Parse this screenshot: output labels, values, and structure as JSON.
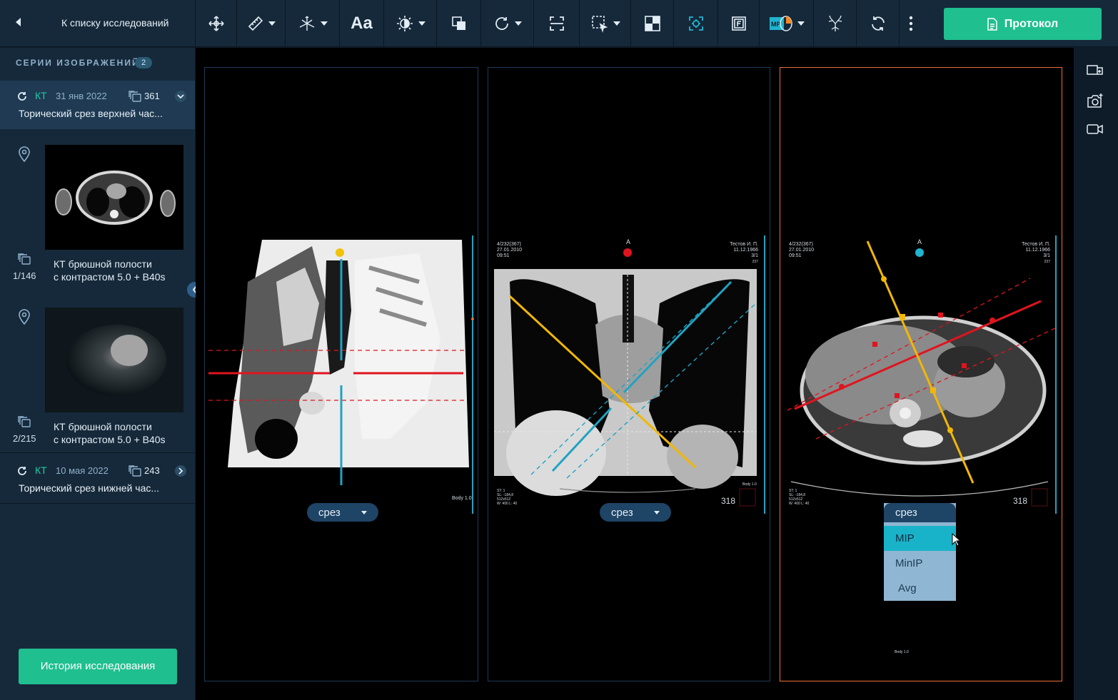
{
  "header": {
    "back_label": "К списку исследований",
    "protocol_label": "Протокол",
    "tools": [
      {
        "icon": "move-icon",
        "dropdown": false
      },
      {
        "icon": "ruler-icon",
        "dropdown": true
      },
      {
        "icon": "axes-3d-icon",
        "dropdown": true
      },
      {
        "icon": "text-annotation-icon",
        "label": "Aa",
        "dropdown": false
      },
      {
        "icon": "brightness-icon",
        "dropdown": true
      },
      {
        "icon": "invert-icon",
        "dropdown": false
      },
      {
        "icon": "rotate-icon",
        "dropdown": true
      },
      {
        "icon": "fit-frame-icon",
        "dropdown": false
      },
      {
        "icon": "select-region-icon",
        "dropdown": true
      },
      {
        "icon": "layout-grid-icon",
        "dropdown": false
      },
      {
        "icon": "focus-target-icon",
        "dropdown": false
      },
      {
        "icon": "frame-f-icon",
        "dropdown": false
      },
      {
        "icon": "mpr-icon",
        "dropdown": true
      },
      {
        "icon": "vessel-tree-icon",
        "dropdown": false
      },
      {
        "icon": "sync-icon",
        "dropdown": false
      },
      {
        "icon": "more-vertical-icon",
        "dropdown": false
      }
    ]
  },
  "sidebar": {
    "series_title": "СЕРИИ ИЗОБРАЖЕНИЙ",
    "series_count": "2",
    "studies": [
      {
        "modality": "КТ",
        "date": "31 янв 2022",
        "count": "361",
        "desc": "Торический срез верхней час..."
      },
      {
        "modality": "КТ",
        "date": "10 мая 2022",
        "count": "243",
        "desc": "Торический срез нижней час..."
      }
    ],
    "thumbnails": [
      {
        "fraction": "1/146",
        "caption1": "КТ брюшной полости",
        "caption2": "с контрастом 5.0 + B40s"
      },
      {
        "fraction": "2/215",
        "caption1": "КТ брюшной полости",
        "caption2": "с контрастом 5.0 + B40s"
      }
    ],
    "history_label": "История исследования"
  },
  "viewports": [
    {
      "mode": "срез"
    },
    {
      "mode": "срез",
      "orientation": "A",
      "info_left": [
        "4/232(367)",
        "27.01.2010",
        "09:51"
      ],
      "info_right": [
        "Тестов И. П.",
        "11.12.1966",
        "3/1",
        "237"
      ],
      "slice": "318",
      "bottom_left": [
        "ST: 1",
        "SL: -184,8",
        "512x512",
        "W: 400 L: 40"
      ],
      "bottom_right": "Body 1.0"
    },
    {
      "mode": "срез",
      "orientation": "A",
      "info_left": [
        "4/232(367)",
        "27.01.2010",
        "09:51"
      ],
      "info_right": [
        "Тестов И. П.",
        "11.12.1966",
        "3/1",
        "237"
      ],
      "slice": "318",
      "bottom_left": [
        "ST: 1",
        "SL: -184,8",
        "512x512",
        "W: 400 L: 40"
      ],
      "bottom_right": "Body 1.0",
      "dropdown_options": [
        "MIP",
        "MinIP",
        "Avg"
      ],
      "selected": "MIP"
    }
  ],
  "vp0_bottom_right": "Body 1.0",
  "colors": {
    "accent": "#1fbf8f",
    "cyan": "#1fa3c2",
    "red": "#e0141e",
    "yellow": "#f2b705",
    "active_border": "#e8703a"
  }
}
